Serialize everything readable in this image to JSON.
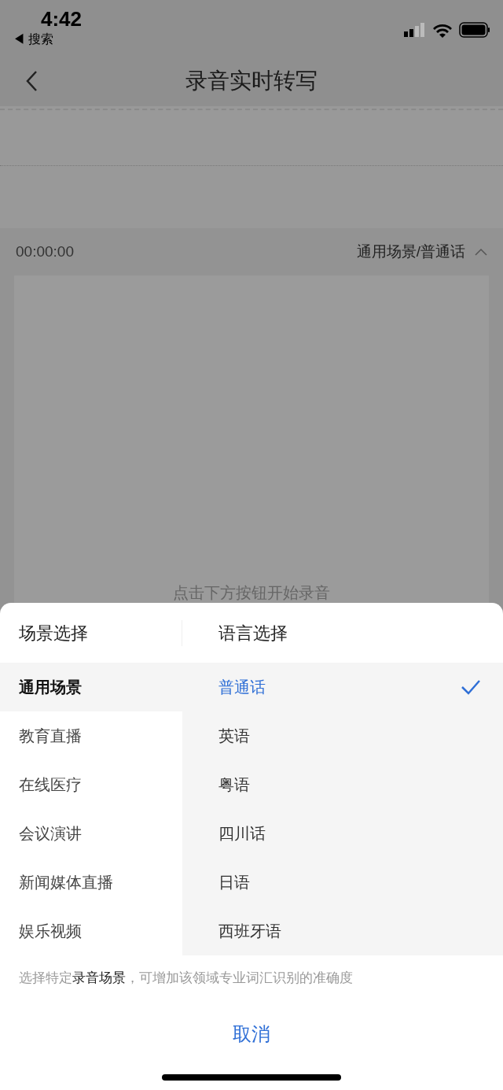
{
  "status_bar": {
    "time": "4:42",
    "back_app": "◀ 搜索"
  },
  "nav": {
    "title": "录音实时转写"
  },
  "recorder": {
    "timer": "00:00:00",
    "mode": "通用场景/普通话",
    "hint": "点击下方按钮开始录音"
  },
  "sheet": {
    "scene_title": "场景选择",
    "language_title": "语言选择",
    "scenes": [
      {
        "label": "通用场景",
        "selected": true
      },
      {
        "label": "教育直播",
        "selected": false
      },
      {
        "label": "在线医疗",
        "selected": false
      },
      {
        "label": "会议演讲",
        "selected": false
      },
      {
        "label": "新闻媒体直播",
        "selected": false
      },
      {
        "label": "娱乐视频",
        "selected": false
      }
    ],
    "languages": [
      {
        "label": "普通话",
        "selected": true
      },
      {
        "label": "英语",
        "selected": false
      },
      {
        "label": "粤语",
        "selected": false
      },
      {
        "label": "四川话",
        "selected": false
      },
      {
        "label": "日语",
        "selected": false
      },
      {
        "label": "西班牙语",
        "selected": false
      }
    ],
    "note": "选择特定**录音场景**，可增加该领域专业词汇识别的准确度",
    "cancel": "取消"
  }
}
